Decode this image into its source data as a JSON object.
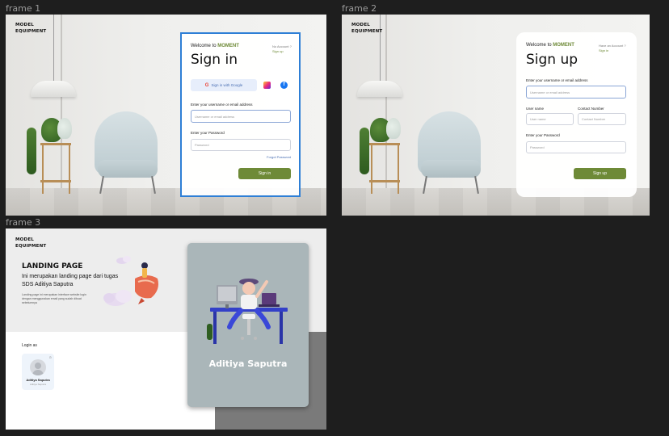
{
  "frames": {
    "frame1": {
      "label": "frame 1"
    },
    "frame2": {
      "label": "frame 2"
    },
    "frame3": {
      "label": "frame 3"
    }
  },
  "brand": {
    "line1": "MODEL",
    "line2": "EQUIPMENT"
  },
  "signin": {
    "welcome_prefix": "Welcome to ",
    "welcome_brand": "MOMENT",
    "title": "Sign in",
    "side_text": "No Account ?",
    "side_link": "Sign up",
    "google_label": "Sign in with Google",
    "username_label": "Enter your username or email address",
    "username_placeholder": "Username or email address",
    "password_label": "Enter your Password",
    "password_placeholder": "Password",
    "forgot_label": "Forgot Password",
    "submit_label": "Sign in"
  },
  "signup": {
    "welcome_prefix": "Welcome to ",
    "welcome_brand": "MOMENT",
    "title": "Sign up",
    "side_text": "Have an Account ?",
    "side_link": "Sign in",
    "username_label": "Enter your username or email address",
    "username_placeholder": "Username or email address",
    "username2_label": "User name",
    "username2_placeholder": "User name",
    "contact_label": "Contact Number",
    "contact_placeholder": "Contact Number",
    "password_label": "Enter your Password",
    "password_placeholder": "Password",
    "submit_label": "Sign up"
  },
  "landing": {
    "title": "LANDING PAGE",
    "subtitle": "Ini merupakan landing page dari tugas SDS Aditiya Saputra",
    "description": "Landing page ini merupakan interface website login dengan menggunakan email yang sudah dibuat sebelumnya",
    "login_as": "Login as",
    "profile_name": "Aditiya Saputra",
    "profile_role": "Aditiya Saputra",
    "card_name": "Aditiya Saputra"
  },
  "colors": {
    "accent": "#6e8a37",
    "selection": "#2e7fd6",
    "canvas": "#1e1e1e"
  }
}
